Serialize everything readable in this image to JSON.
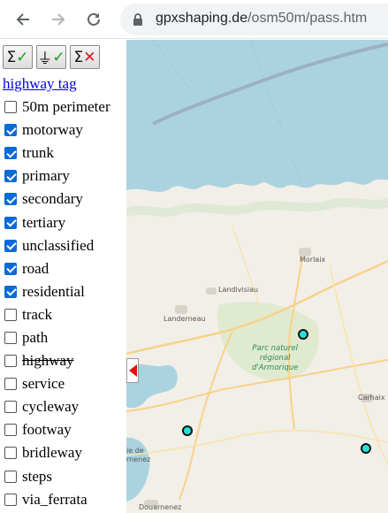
{
  "browser": {
    "url_host": "gpxshaping.de",
    "url_path": "/osm50m/pass.htm"
  },
  "panel": {
    "buttons": {
      "select_all": {
        "symbol": "Σ",
        "mark": "✓",
        "icon": "sigma-check-icon"
      },
      "select_ground": {
        "symbol": "⏚",
        "mark": "✓",
        "icon": "ground-check-icon"
      },
      "clear_all": {
        "symbol": "Σ",
        "mark": "✕",
        "icon": "sigma-cross-icon"
      }
    },
    "tag_link": "highway tag",
    "items": [
      {
        "label": "50m perimeter",
        "checked": false
      },
      {
        "label": "motorway",
        "checked": true
      },
      {
        "label": "trunk",
        "checked": true
      },
      {
        "label": "primary",
        "checked": true
      },
      {
        "label": "secondary",
        "checked": true
      },
      {
        "label": "tertiary",
        "checked": true
      },
      {
        "label": "unclassified",
        "checked": true
      },
      {
        "label": "road",
        "checked": true
      },
      {
        "label": "residential",
        "checked": true
      },
      {
        "label": "track",
        "checked": false
      },
      {
        "label": "path",
        "checked": false
      },
      {
        "label": "highway",
        "checked": false,
        "strikethrough": true
      },
      {
        "label": "service",
        "checked": false
      },
      {
        "label": "cycleway",
        "checked": false
      },
      {
        "label": "footway",
        "checked": false
      },
      {
        "label": "bridleway",
        "checked": false
      },
      {
        "label": "steps",
        "checked": false
      },
      {
        "label": "via_ferrata",
        "checked": false
      }
    ]
  },
  "map": {
    "labels": {
      "morlaix": "Morlaix",
      "landivisiau": "Landivisiau",
      "landerneau": "Landerneau",
      "carhaix": "Carhaix",
      "douarnenez": "Douarnenez",
      "crozon": "ie de",
      "crozon2": "rnenez"
    },
    "park_label_lines": [
      "Parc naturel",
      "régional",
      "d'Armorique"
    ],
    "colors": {
      "sea": "#aad3df",
      "land": "#f2efe9",
      "marker": "#28e0d8",
      "park": "#cfe8bd"
    }
  }
}
